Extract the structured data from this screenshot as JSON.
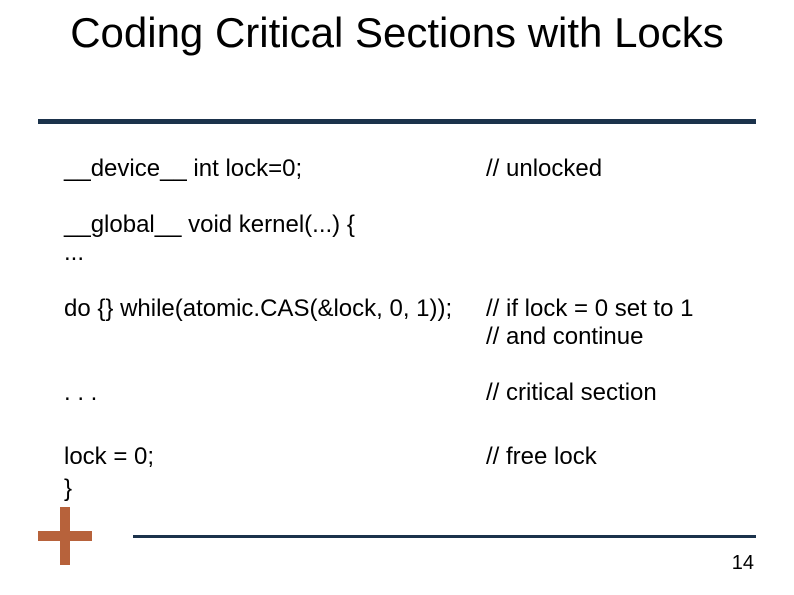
{
  "slide": {
    "title": "Coding Critical Sections with Locks",
    "code": {
      "line1": "__device__ int lock=0;",
      "line1_comment": "// unlocked",
      "line2": "__global__ void kernel(...) {",
      "line3": "...",
      "line4": "do {} while(atomic.CAS(&lock, 0, 1));",
      "line4_comment_a": "// if lock = 0 set to 1",
      "line4_comment_b": "// and continue",
      "line5": ". . .",
      "line5_comment": "// critical section",
      "line6": "lock = 0;",
      "line6_comment": "// free lock",
      "line7": "}"
    },
    "number": "14"
  }
}
